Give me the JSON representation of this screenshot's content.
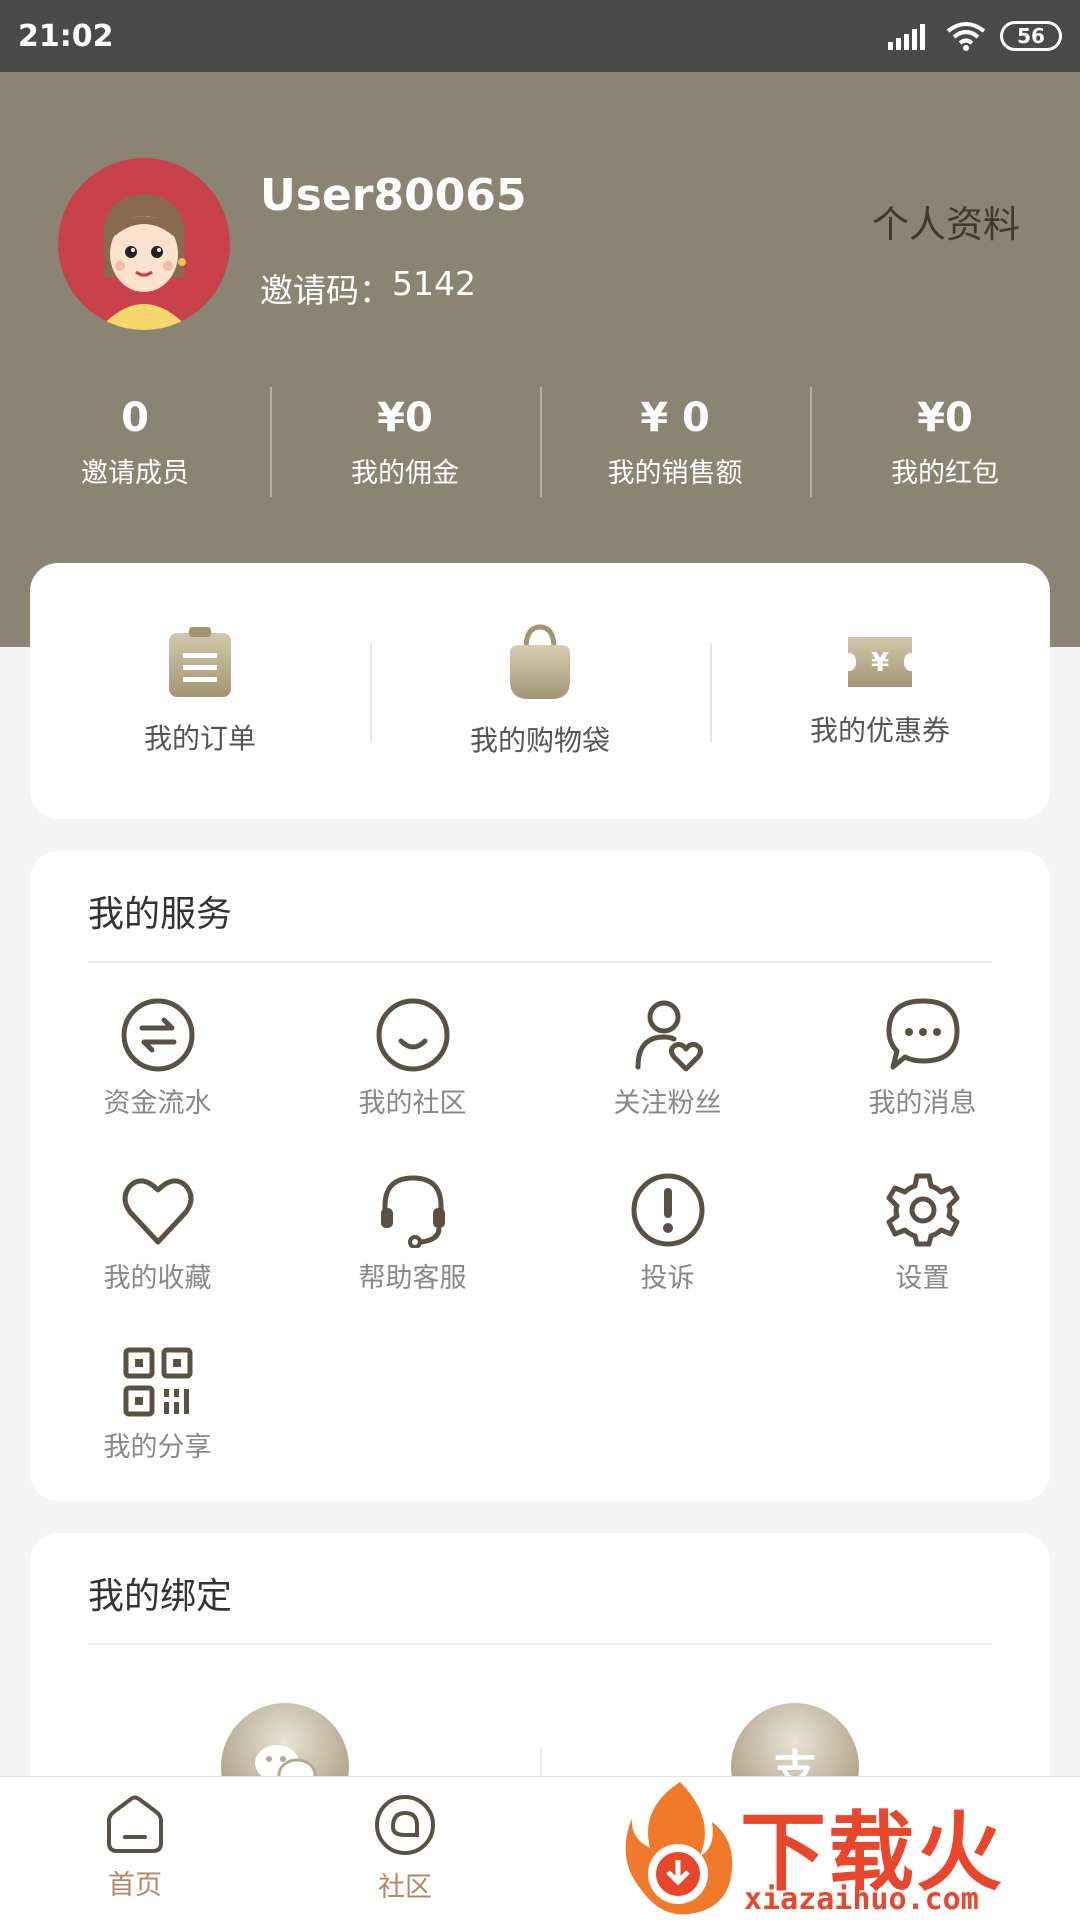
{
  "status_bar": {
    "time": "21:02",
    "battery": "56"
  },
  "profile": {
    "username": "User80065",
    "invite_label": "邀请码：",
    "invite_code": "5142",
    "profile_link": "个人资料"
  },
  "stats": [
    {
      "value": "0",
      "label": "邀请成员"
    },
    {
      "value": "¥0",
      "label": "我的佣金"
    },
    {
      "value": "¥ 0",
      "label": "我的销售额"
    },
    {
      "value": "¥0",
      "label": "我的红包"
    }
  ],
  "quick_actions": [
    {
      "label": "我的订单",
      "icon": "clipboard-icon"
    },
    {
      "label": "我的购物袋",
      "icon": "shopping-bag-icon"
    },
    {
      "label": "我的优惠券",
      "icon": "coupon-icon"
    }
  ],
  "services": {
    "title": "我的服务",
    "items": [
      {
        "label": "资金流水",
        "icon": "transfer-icon"
      },
      {
        "label": "我的社区",
        "icon": "smile-icon"
      },
      {
        "label": "关注粉丝",
        "icon": "user-heart-icon"
      },
      {
        "label": "我的消息",
        "icon": "chat-bubble-icon"
      },
      {
        "label": "我的收藏",
        "icon": "heart-icon"
      },
      {
        "label": "帮助客服",
        "icon": "headset-icon"
      },
      {
        "label": "投诉",
        "icon": "alert-icon"
      },
      {
        "label": "设置",
        "icon": "gear-icon"
      },
      {
        "label": "我的分享",
        "icon": "qr-code-icon"
      }
    ]
  },
  "bindings": {
    "title": "我的绑定",
    "items": [
      {
        "icon": "wechat-icon",
        "glyph": ""
      },
      {
        "icon": "alipay-icon",
        "glyph": "支"
      }
    ]
  },
  "bottom_nav": [
    {
      "label": "首页",
      "icon": "home-icon"
    },
    {
      "label": "社区",
      "icon": "community-icon"
    }
  ],
  "watermark": {
    "text": "下载火",
    "sub": "xiazaihuo.com"
  },
  "colors": {
    "header_bg": "#8c8472",
    "accent": "#b98561",
    "icon": "#5a5143"
  }
}
